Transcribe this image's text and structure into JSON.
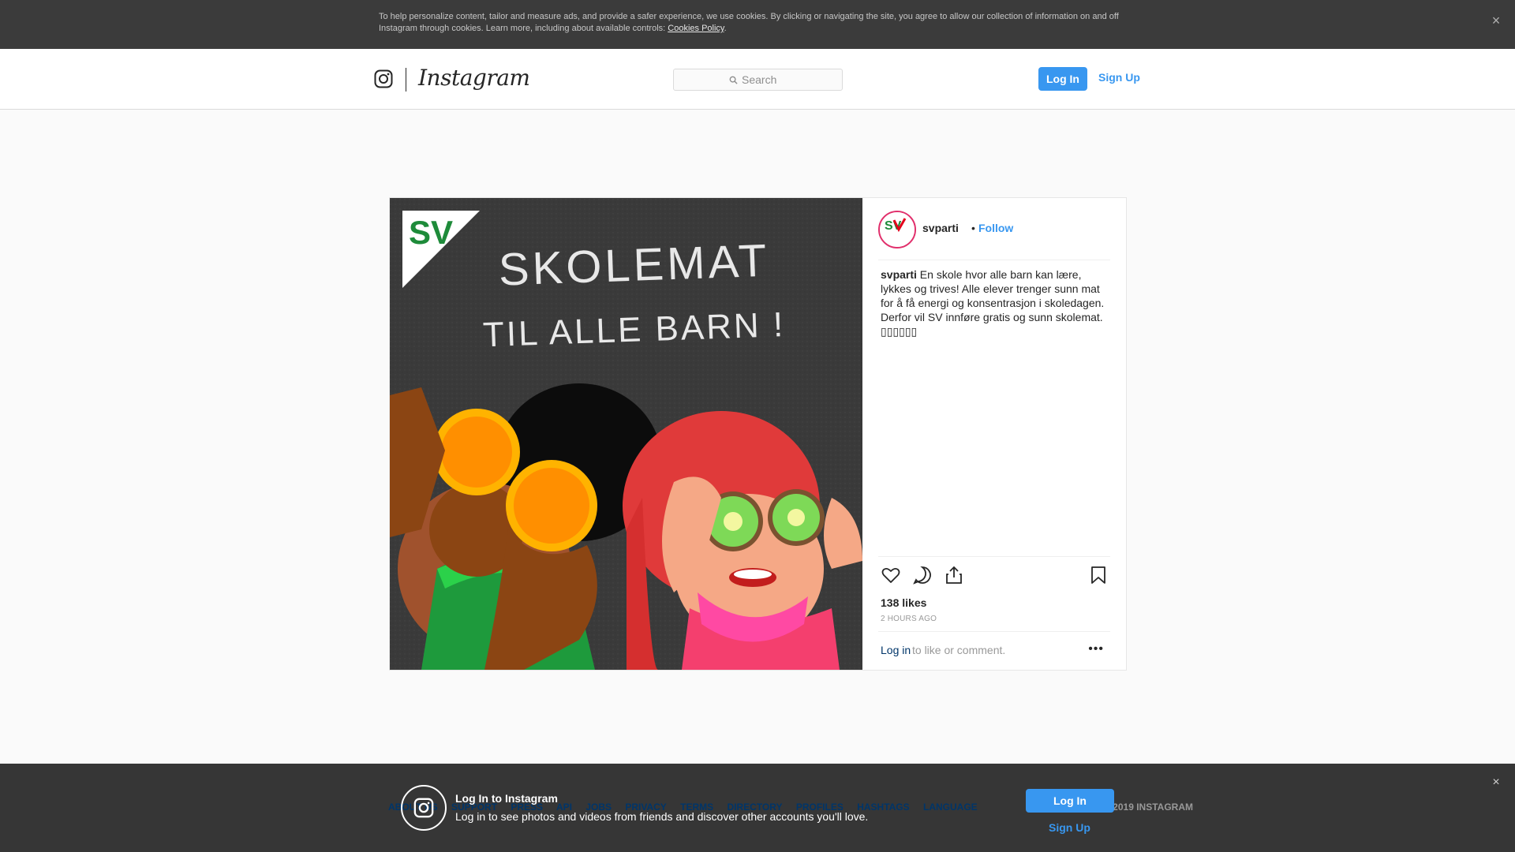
{
  "cookie_banner": {
    "text": "To help personalize content, tailor and measure ads, and provide a safer experience, we use cookies. By clicking or navigating the site, you agree to allow our collection of information on and off Instagram through cookies. Learn more, including about available controls: ",
    "link": "Cookies Policy",
    "after_link": ".",
    "close": "×"
  },
  "header": {
    "wordmark": "Instagram",
    "search_placeholder": "Search",
    "login": "Log In",
    "signup": "Sign Up"
  },
  "post": {
    "image": {
      "badge": "SV",
      "line1": "SKOLEMAT",
      "line2": "TIL ALLE BARN !"
    },
    "author": "svparti",
    "separator": "•",
    "follow": "Follow",
    "caption_user": "svparti",
    "caption_text": " En skole hvor alle barn kan lære, lykkes og trives! Alle elever trenger sunn mat for å få energi og konsentrasjon i skoledagen. Derfor vil SV innføre gratis og sunn skolemat.",
    "caption_emoji": "▯▯▯▯▯▯",
    "likes": "138 likes",
    "time": "2 HOURS AGO",
    "comment_login": "Log in",
    "comment_rest": " to like or comment.",
    "more": "•••"
  },
  "footer": {
    "links": [
      "ABOUT US",
      "SUPPORT",
      "PRESS",
      "API",
      "JOBS",
      "PRIVACY",
      "TERMS",
      "DIRECTORY",
      "PROFILES",
      "HASHTAGS",
      "LANGUAGE"
    ],
    "copyright": "© 2019 INSTAGRAM"
  },
  "login_banner": {
    "title": "Log In to Instagram",
    "subtitle": "Log in to see photos and videos from friends and discover other accounts you'll love.",
    "login": "Log In",
    "signup": "Sign Up",
    "close": "×"
  },
  "colors": {
    "accent": "#3897f0",
    "cookie_bg": "#3b3b3b",
    "chalkboard": "#3b3b3b",
    "sv_red": "#e3001b",
    "sv_green": "#1e8b3a"
  }
}
